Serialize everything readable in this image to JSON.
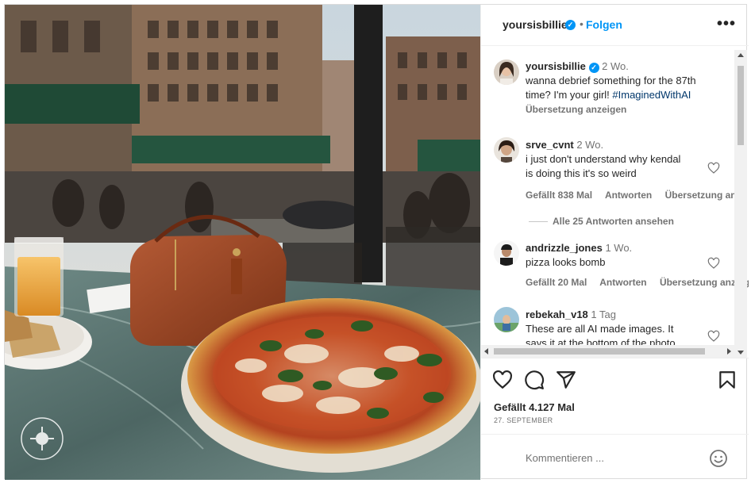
{
  "post": {
    "username": "yoursisbillie",
    "follow_label": "Folgen",
    "more_label": "•••",
    "verified_mark": "✓"
  },
  "caption": {
    "username": "yoursisbillie",
    "time": "2 Wo.",
    "line1": "wanna debrief something for the 87th",
    "line2_pre": "time? I'm your girl! ",
    "hashtag": "#ImaginedWithAI",
    "translate": "Übersetzung anzeigen"
  },
  "comments": [
    {
      "username": "srve_cvnt",
      "time": "2 Wo.",
      "line1": "i just don't understand why kendal",
      "line2": "is doing this it's so weird",
      "likes": "Gefällt 838 Mal",
      "reply": "Antworten",
      "translate": "Übersetzung anze"
    },
    {
      "username": "andrizzle_jones",
      "time": "1 Wo.",
      "line1": "pizza looks bomb",
      "likes": "Gefällt 20 Mal",
      "reply": "Antworten",
      "translate": "Übersetzung anzeig"
    },
    {
      "username": "rebekah_v18",
      "time": "1 Tag",
      "line1": "These are all AI made images. It",
      "line2": "says it at the bottom of the photo"
    }
  ],
  "see_replies": "Alle 25 Antworten ansehen",
  "actions": {
    "likes": "Gefällt 4.127 Mal",
    "date": "27. SEPTEMBER",
    "icons": [
      "heart-icon",
      "comment-icon",
      "share-icon",
      "bookmark-icon"
    ]
  },
  "comment_input": {
    "placeholder": "Kommentieren ..."
  },
  "colors": {
    "accent": "#0095f6",
    "text": "#262626",
    "secondary": "#737373"
  }
}
